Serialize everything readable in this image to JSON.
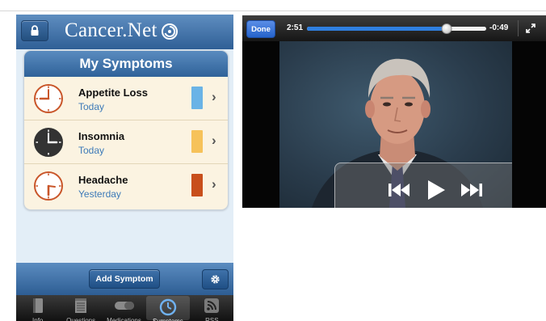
{
  "app": {
    "brand": "Cancer.Net",
    "card_title": "My Symptoms",
    "symptoms": [
      {
        "name": "Appetite Loss",
        "date": "Today",
        "color": "#6ab3e6",
        "clock_color": "#c9562a",
        "clock_bg": "#ffffff"
      },
      {
        "name": "Insomnia",
        "date": "Today",
        "color": "#f6c25a",
        "clock_color": "#333333",
        "clock_bg": "#333333"
      },
      {
        "name": "Headache",
        "date": "Yesterday",
        "color": "#c84f1c",
        "clock_color": "#c9562a",
        "clock_bg": "#ffffff"
      }
    ],
    "add_button": "Add Symptom",
    "tabs": [
      {
        "label": "Info",
        "icon": "book-icon"
      },
      {
        "label": "Questions",
        "icon": "notepad-icon"
      },
      {
        "label": "Medications",
        "icon": "pill-icon"
      },
      {
        "label": "Symptoms",
        "icon": "clock-icon",
        "active": true
      },
      {
        "label": "RSS",
        "icon": "rss-icon"
      }
    ]
  },
  "video": {
    "done_label": "Done",
    "elapsed": "2:51",
    "remaining": "-0:49",
    "progress": 0.78
  },
  "colors": {
    "accent_blue": "#2f6299",
    "progress_blue": "#2f7fe0"
  }
}
